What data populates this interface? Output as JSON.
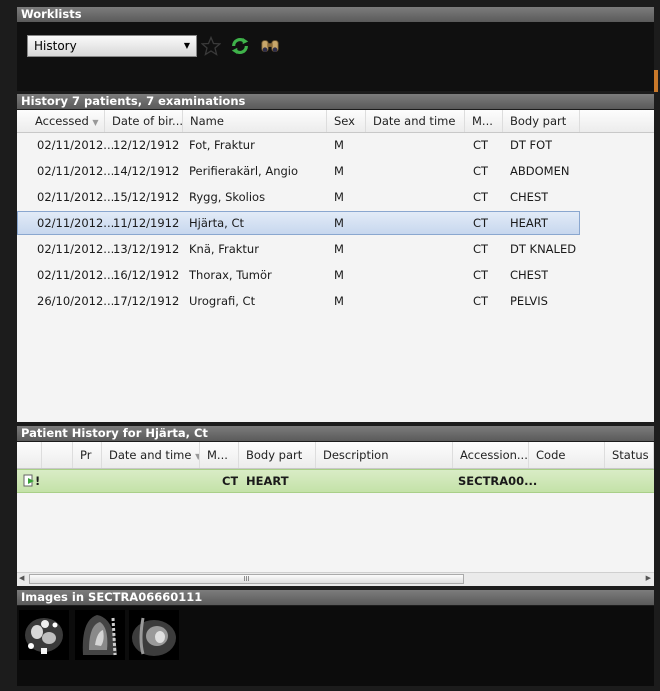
{
  "worklists": {
    "title": "Worklists",
    "selected_list": "History"
  },
  "history": {
    "title": "History    7 patients, 7 examinations",
    "columns": [
      "Accessed",
      "Date of bir...",
      "Name",
      "Sex",
      "Date and time",
      "M...",
      "Body part"
    ],
    "rows": [
      {
        "accessed": "02/11/2012...",
        "dob": "12/12/1912",
        "name": "Fot, Fraktur",
        "sex": "M",
        "datetime": "",
        "modality": "CT",
        "body_part": "DT FOT"
      },
      {
        "accessed": "02/11/2012...",
        "dob": "14/12/1912",
        "name": "Perifierakärl, Angio",
        "sex": "M",
        "datetime": "",
        "modality": "CT",
        "body_part": "ABDOMEN"
      },
      {
        "accessed": "02/11/2012...",
        "dob": "15/12/1912",
        "name": "Rygg, Skolios",
        "sex": "M",
        "datetime": "",
        "modality": "CT",
        "body_part": "CHEST"
      },
      {
        "accessed": "02/11/2012...",
        "dob": "11/12/1912",
        "name": "Hjärta, Ct",
        "sex": "M",
        "datetime": "",
        "modality": "CT",
        "body_part": "HEART"
      },
      {
        "accessed": "02/11/2012...",
        "dob": "13/12/1912",
        "name": "Knä, Fraktur",
        "sex": "M",
        "datetime": "",
        "modality": "CT",
        "body_part": "DT KNALED"
      },
      {
        "accessed": "02/11/2012...",
        "dob": "16/12/1912",
        "name": "Thorax, Tumör",
        "sex": "M",
        "datetime": "",
        "modality": "CT",
        "body_part": "CHEST"
      },
      {
        "accessed": "26/10/2012...",
        "dob": "17/12/1912",
        "name": "Urografi, Ct",
        "sex": "M",
        "datetime": "",
        "modality": "CT",
        "body_part": "PELVIS"
      }
    ]
  },
  "patient_history": {
    "title": "Patient History for Hjärta, Ct",
    "columns": [
      "Pr",
      "Date and time",
      "M...",
      "Body part",
      "Description",
      "Accession...",
      "Code",
      "Status"
    ],
    "rows": [
      {
        "flag": "!",
        "datetime": "",
        "modality": "CT",
        "body_part": "HEART",
        "description": "",
        "accession": "SECTRA00...",
        "code": "",
        "status": ""
      }
    ],
    "scrollbar_grip": "III"
  },
  "images": {
    "title": "Images in SECTRA06660111",
    "thumbnails": [
      "ct-heart-axial",
      "ct-heart-sagittal",
      "ct-heart-coronal"
    ]
  }
}
